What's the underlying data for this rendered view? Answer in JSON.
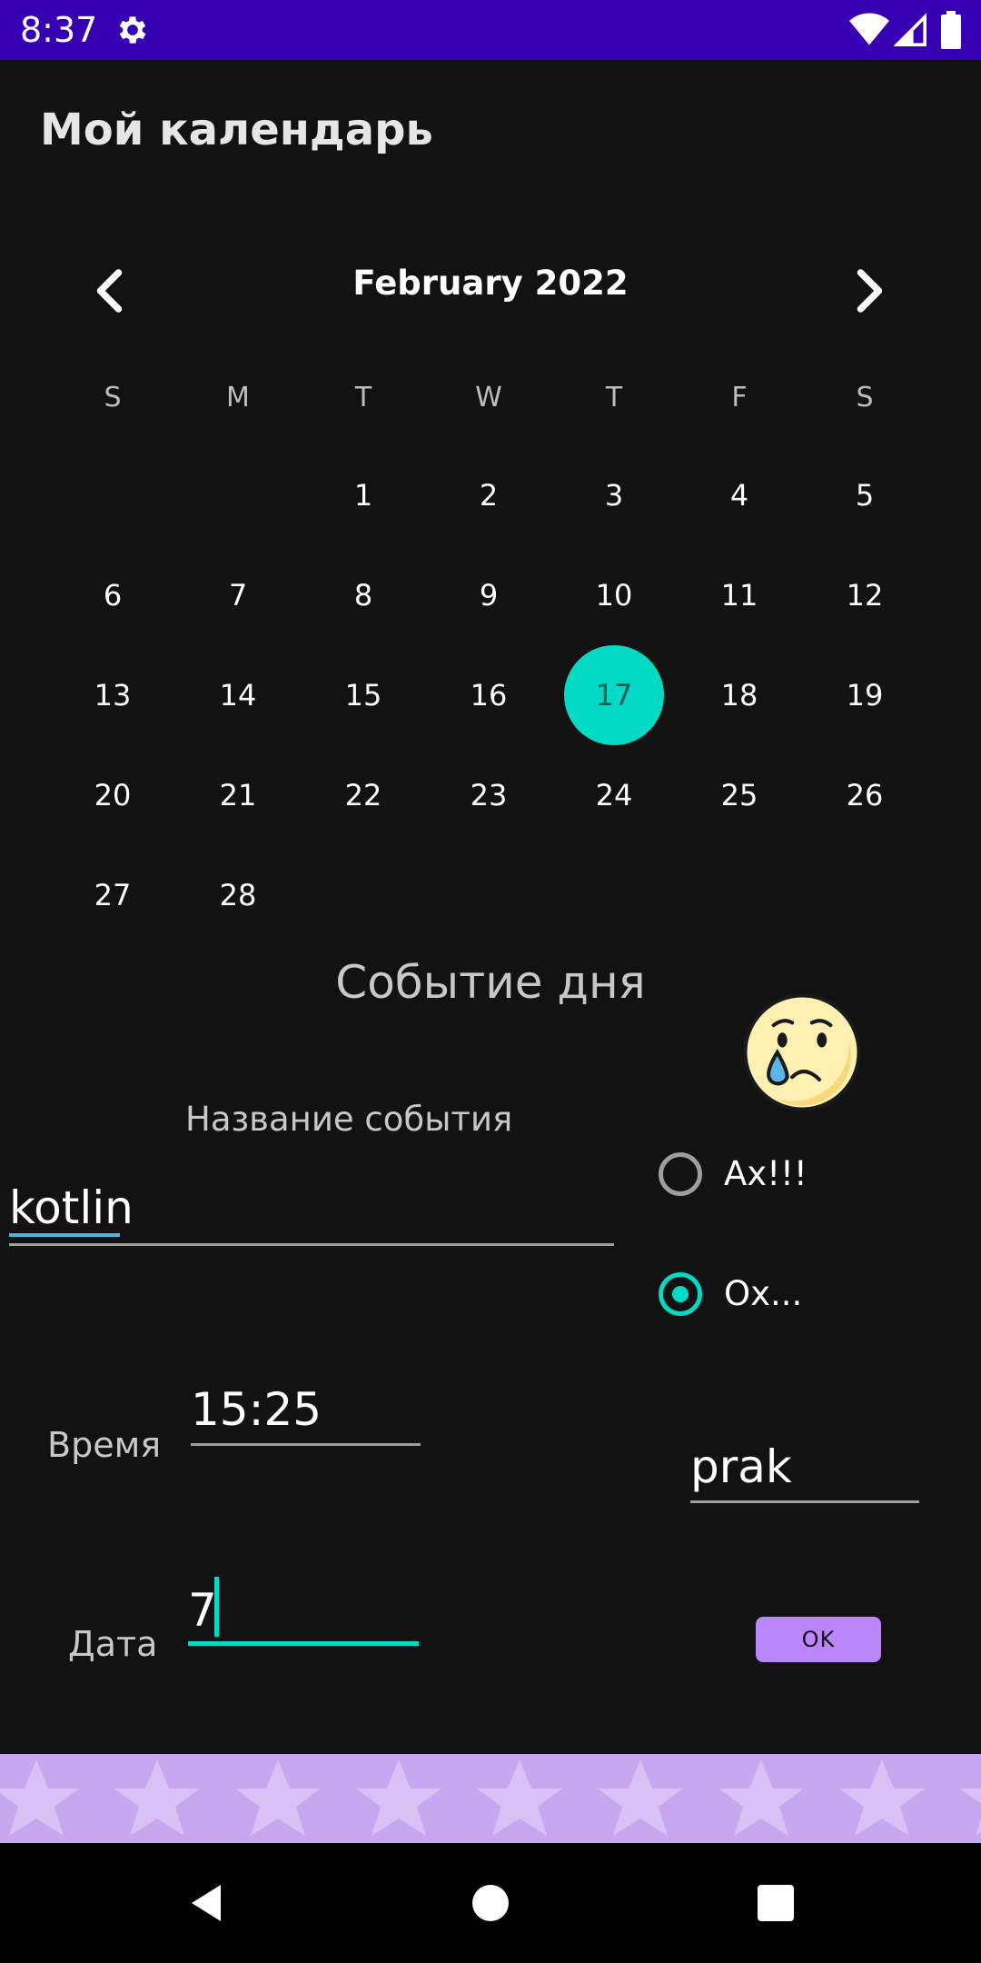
{
  "status_bar": {
    "time": "8:37"
  },
  "app_title": "Мой календарь",
  "calendar": {
    "month_label": "February 2022",
    "weekdays": [
      "S",
      "M",
      "T",
      "W",
      "T",
      "F",
      "S"
    ],
    "first_weekday_index": 2,
    "days_in_month": 28,
    "selected_day": "17",
    "selected_color": "#03dac5"
  },
  "event": {
    "section_title": "Событие дня",
    "name_label": "Название события",
    "name_value": "kotlin",
    "mood_icon": "crying-face-icon",
    "radio_options": [
      {
        "label": "Ах!!!",
        "selected": false
      },
      {
        "label": "Ох...",
        "selected": true
      }
    ],
    "time_label": "Время",
    "time_value": "15:25",
    "extra_value": "prak",
    "date_label": "Дата",
    "date_value": "7",
    "ok_label": "OK"
  },
  "colors": {
    "status_bar": "#3700b3",
    "accent": "#03dac5",
    "button": "#bb86fc",
    "background": "#121212"
  }
}
